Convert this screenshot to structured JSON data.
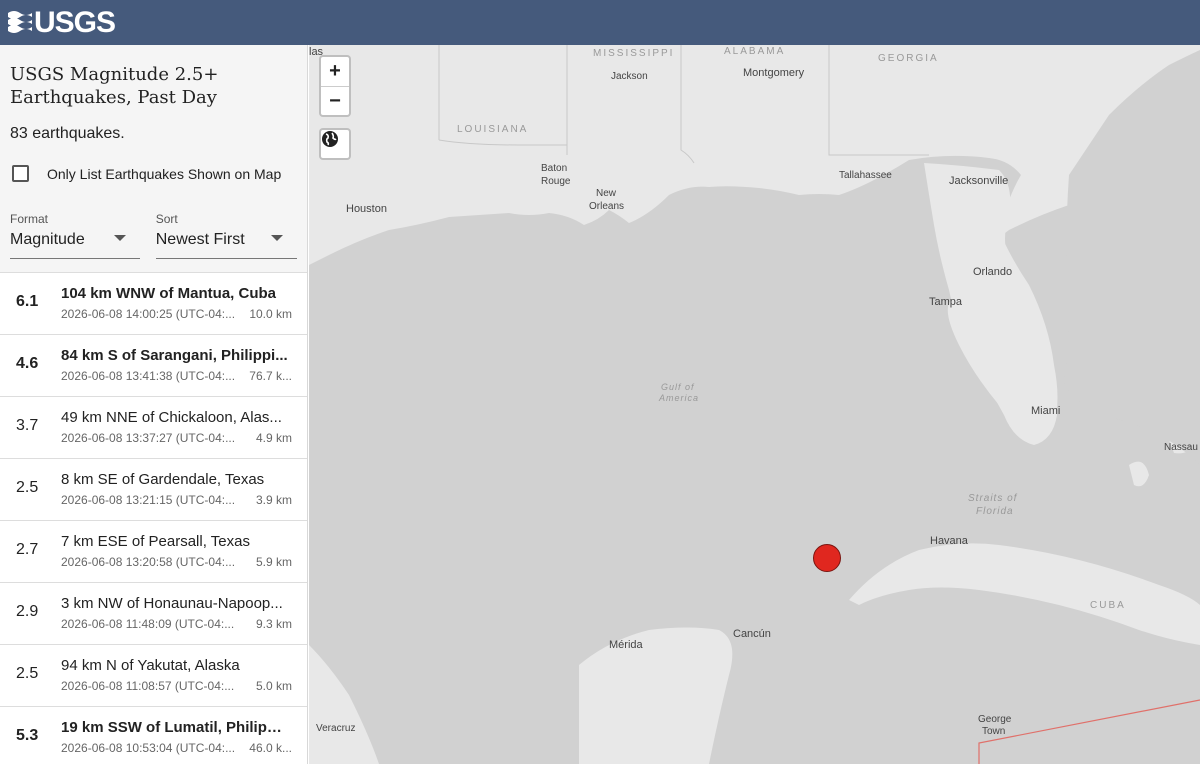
{
  "header": {
    "logo_text": "USGS"
  },
  "sidebar": {
    "title": "USGS Magnitude 2.5+ Earthquakes, Past Day",
    "count_text": "83 earthquakes.",
    "filter_label": "Only List Earthquakes Shown on Map",
    "format": {
      "label": "Format",
      "value": "Magnitude"
    },
    "sort": {
      "label": "Sort",
      "value": "Newest First"
    }
  },
  "quakes": [
    {
      "mag": "6.1",
      "place": "104 km WNW of Mantua, Cuba",
      "time": "2026-06-08 14:00:25 (UTC-04:...",
      "depth": "10.0 km"
    },
    {
      "mag": "4.6",
      "place": "84 km S of Sarangani, Philippi...",
      "time": "2026-06-08 13:41:38 (UTC-04:...",
      "depth": "76.7 k..."
    },
    {
      "mag": "3.7",
      "place": "49 km NNE of Chickaloon, Alas...",
      "time": "2026-06-08 13:37:27 (UTC-04:...",
      "depth": "4.9 km"
    },
    {
      "mag": "2.5",
      "place": "8 km SE of Gardendale, Texas",
      "time": "2026-06-08 13:21:15 (UTC-04:...",
      "depth": "3.9 km"
    },
    {
      "mag": "2.7",
      "place": "7 km ESE of Pearsall, Texas",
      "time": "2026-06-08 13:20:58 (UTC-04:...",
      "depth": "5.9 km"
    },
    {
      "mag": "2.9",
      "place": "3 km NW of Honaunau-Napoop...",
      "time": "2026-06-08 11:48:09 (UTC-04:...",
      "depth": "9.3 km"
    },
    {
      "mag": "2.5",
      "place": "94 km N of Yakutat, Alaska",
      "time": "2026-06-08 11:08:57 (UTC-04:...",
      "depth": "5.0 km"
    },
    {
      "mag": "5.3",
      "place": "19 km SSW of Lumatil, Philippi...",
      "time": "2026-06-08 10:53:04 (UTC-04:...",
      "depth": "46.0 k..."
    }
  ],
  "map": {
    "zoom_in": "+",
    "zoom_out": "−",
    "labels": {
      "las": "las",
      "mississippi": "MISSISSIPPI",
      "alabama": "ALABAMA",
      "georgia": "GEORGIA",
      "jackson": "Jackson",
      "montgomery": "Montgomery",
      "louisiana": "LOUISIANA",
      "baton_rouge_1": "Baton",
      "baton_rouge_2": "Rouge",
      "new_orleans_1": "New",
      "new_orleans_2": "Orleans",
      "tallahassee": "Tallahassee",
      "jacksonville": "Jacksonville",
      "houston": "Houston",
      "orlando": "Orlando",
      "tampa": "Tampa",
      "miami": "Miami",
      "nassau": "Nassau",
      "gulf_1": "Gulf of",
      "gulf_2": "America",
      "straits_1": "Straits of",
      "straits_2": "Florida",
      "havana": "Havana",
      "cuba": "CUBA",
      "merida": "Mérida",
      "cancun": "Cancún",
      "veracruz": "Veracruz",
      "george_town_1": "George",
      "george_town_2": "Town"
    },
    "colors": {
      "land": "#e8e8e8",
      "water": "#d1d1d1",
      "marker": "#e0271f",
      "border": "#c0392b"
    }
  }
}
